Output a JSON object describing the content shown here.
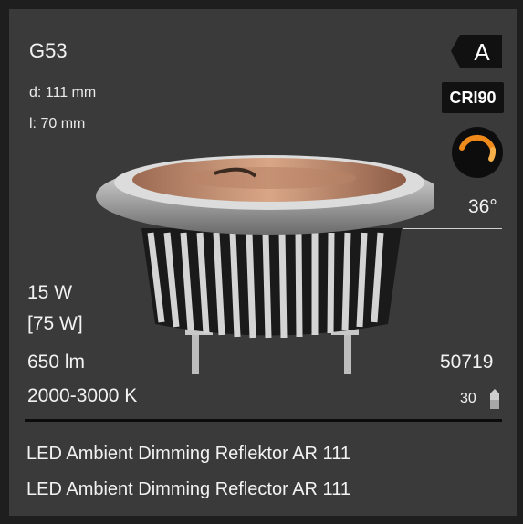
{
  "product": {
    "socket": "G53",
    "diameter": "d: 111 mm",
    "length": "l:  70 mm",
    "power": "15 W",
    "power_equivalent": "[75 W]",
    "lumen": "650 lm",
    "color_temperature": "2000-3000 K",
    "beam_angle": "36°",
    "article_number": "50719",
    "pack_quantity": "30",
    "energy_class": "A",
    "cri": "CRI90",
    "name_de": "LED Ambient Dimming Reflektor AR 111",
    "name_en": "LED Ambient Dimming Reflector AR 111"
  },
  "icons": {
    "energy": "energy-label-icon",
    "dimming": "ambient-dimming-icon",
    "package": "package-icon"
  },
  "colors": {
    "background": "#3a3a3a",
    "text": "#f2f2f2",
    "dim_orange": "#f08a1a"
  }
}
